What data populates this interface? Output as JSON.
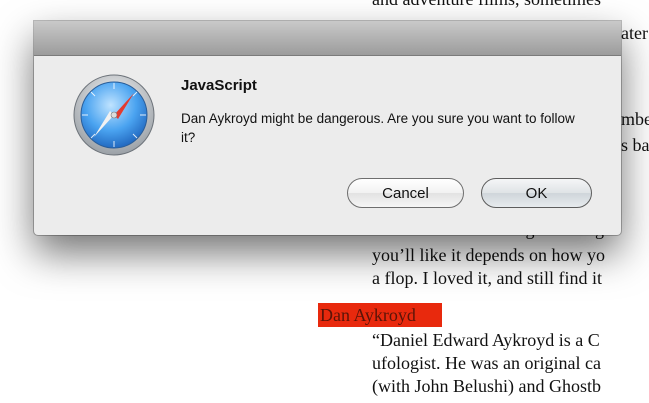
{
  "background_text": {
    "lines_top": [
      "and adventure films, sometimes",
      "ater",
      "mbe",
      "s ba"
    ],
    "lines_mid": [
      "I would the rest with great design",
      "you’ll like it depends on how yo",
      "a flop. I loved it, and still find it"
    ],
    "highlight": "Dan Aykroyd",
    "lines_bottom": [
      "“Daniel Edward Aykroyd is a C",
      "ufologist. He was an original ca",
      "(with John Belushi) and Ghostb"
    ]
  },
  "dialog": {
    "title": "JavaScript",
    "message": "Dan Aykroyd might be dangerous. Are you sure you want to follow it?",
    "cancel_label": "Cancel",
    "ok_label": "OK"
  },
  "colors": {
    "highlight": "#e8290d",
    "dialog_bg": "#ececec"
  },
  "icons": {
    "app_icon": "safari-compass-icon"
  }
}
